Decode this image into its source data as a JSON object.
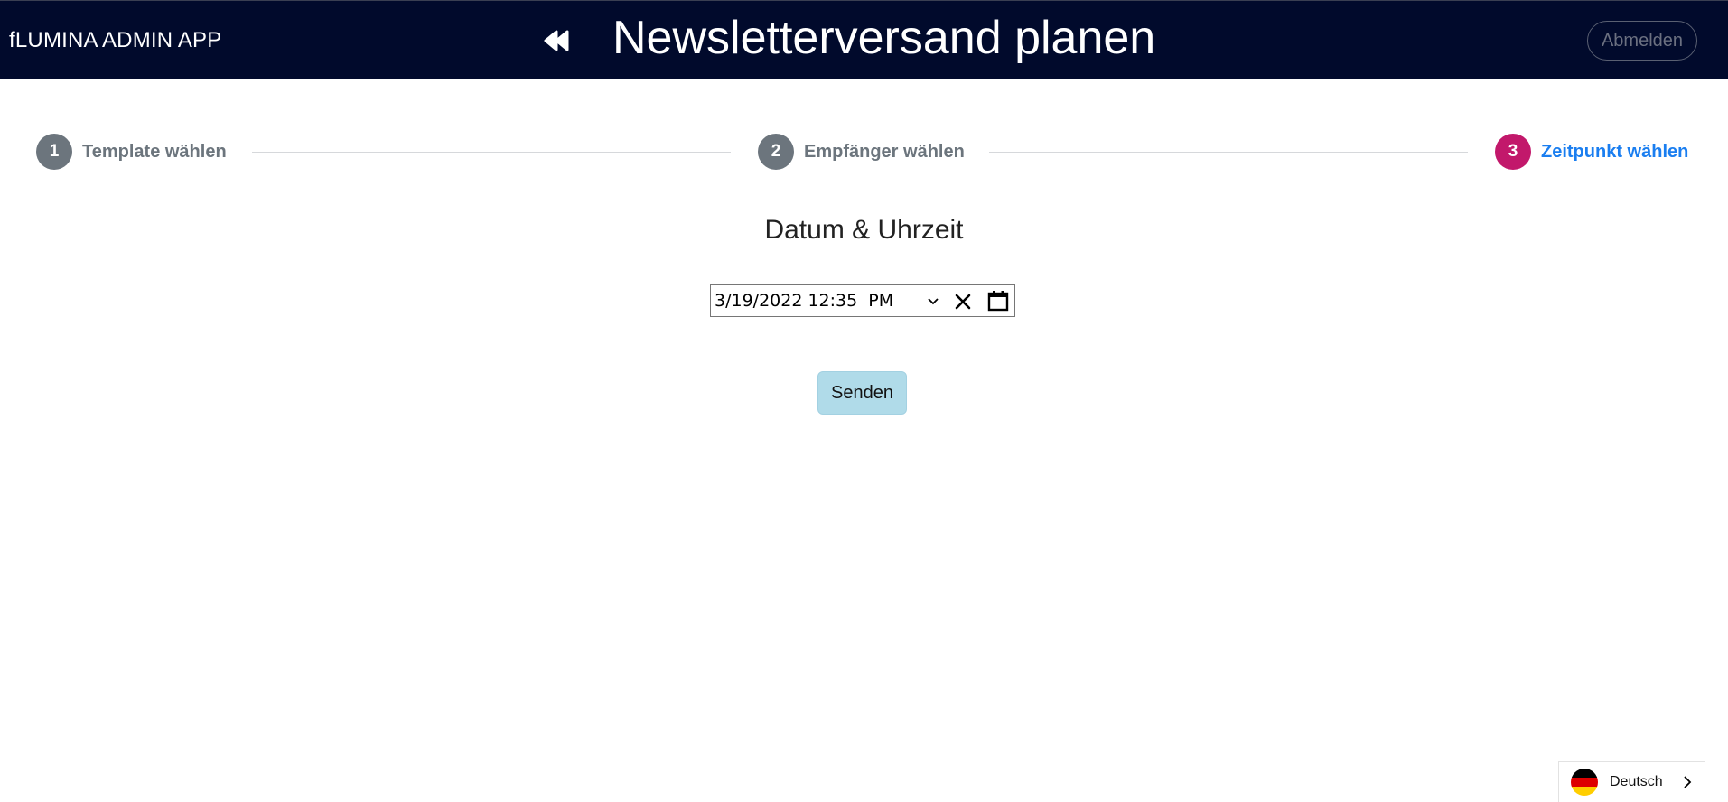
{
  "header": {
    "app_title": "fLUMINA ADMIN APP",
    "page_title": "Newsletterversand planen",
    "logout_label": "Abmelden",
    "back_icon": "double-chevron-left-icon"
  },
  "stepper": {
    "steps": [
      {
        "number": "1",
        "label": "Template wählen",
        "state": "done"
      },
      {
        "number": "2",
        "label": "Empfänger wählen",
        "state": "done"
      },
      {
        "number": "3",
        "label": "Zeitpunkt wählen",
        "state": "active"
      }
    ]
  },
  "schedule": {
    "heading": "Datum & Uhrzeit",
    "datetime_value": "3/19/2022 12:35  PM",
    "icons": [
      "chevron-down-icon",
      "close-icon",
      "calendar-icon"
    ],
    "send_label": "Senden"
  },
  "language": {
    "label": "Deutsch",
    "flag": "german-flag-icon"
  },
  "colors": {
    "header_bg": "#010a2c",
    "step_done": "#6c757d",
    "step_active_circle": "#c2186b",
    "step_active_label": "#1a7ef0",
    "send_button_bg": "#b0dbe9"
  }
}
